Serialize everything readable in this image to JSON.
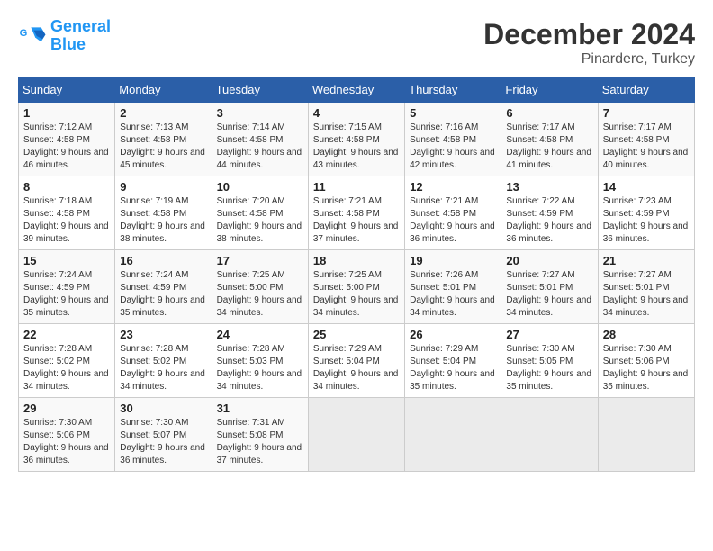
{
  "logo": {
    "line1": "General",
    "line2": "Blue"
  },
  "title": "December 2024",
  "subtitle": "Pinardere, Turkey",
  "days_header": [
    "Sunday",
    "Monday",
    "Tuesday",
    "Wednesday",
    "Thursday",
    "Friday",
    "Saturday"
  ],
  "weeks": [
    [
      {
        "num": "1",
        "sunrise": "Sunrise: 7:12 AM",
        "sunset": "Sunset: 4:58 PM",
        "daylight": "Daylight: 9 hours and 46 minutes."
      },
      {
        "num": "2",
        "sunrise": "Sunrise: 7:13 AM",
        "sunset": "Sunset: 4:58 PM",
        "daylight": "Daylight: 9 hours and 45 minutes."
      },
      {
        "num": "3",
        "sunrise": "Sunrise: 7:14 AM",
        "sunset": "Sunset: 4:58 PM",
        "daylight": "Daylight: 9 hours and 44 minutes."
      },
      {
        "num": "4",
        "sunrise": "Sunrise: 7:15 AM",
        "sunset": "Sunset: 4:58 PM",
        "daylight": "Daylight: 9 hours and 43 minutes."
      },
      {
        "num": "5",
        "sunrise": "Sunrise: 7:16 AM",
        "sunset": "Sunset: 4:58 PM",
        "daylight": "Daylight: 9 hours and 42 minutes."
      },
      {
        "num": "6",
        "sunrise": "Sunrise: 7:17 AM",
        "sunset": "Sunset: 4:58 PM",
        "daylight": "Daylight: 9 hours and 41 minutes."
      },
      {
        "num": "7",
        "sunrise": "Sunrise: 7:17 AM",
        "sunset": "Sunset: 4:58 PM",
        "daylight": "Daylight: 9 hours and 40 minutes."
      }
    ],
    [
      {
        "num": "8",
        "sunrise": "Sunrise: 7:18 AM",
        "sunset": "Sunset: 4:58 PM",
        "daylight": "Daylight: 9 hours and 39 minutes."
      },
      {
        "num": "9",
        "sunrise": "Sunrise: 7:19 AM",
        "sunset": "Sunset: 4:58 PM",
        "daylight": "Daylight: 9 hours and 38 minutes."
      },
      {
        "num": "10",
        "sunrise": "Sunrise: 7:20 AM",
        "sunset": "Sunset: 4:58 PM",
        "daylight": "Daylight: 9 hours and 38 minutes."
      },
      {
        "num": "11",
        "sunrise": "Sunrise: 7:21 AM",
        "sunset": "Sunset: 4:58 PM",
        "daylight": "Daylight: 9 hours and 37 minutes."
      },
      {
        "num": "12",
        "sunrise": "Sunrise: 7:21 AM",
        "sunset": "Sunset: 4:58 PM",
        "daylight": "Daylight: 9 hours and 36 minutes."
      },
      {
        "num": "13",
        "sunrise": "Sunrise: 7:22 AM",
        "sunset": "Sunset: 4:59 PM",
        "daylight": "Daylight: 9 hours and 36 minutes."
      },
      {
        "num": "14",
        "sunrise": "Sunrise: 7:23 AM",
        "sunset": "Sunset: 4:59 PM",
        "daylight": "Daylight: 9 hours and 36 minutes."
      }
    ],
    [
      {
        "num": "15",
        "sunrise": "Sunrise: 7:24 AM",
        "sunset": "Sunset: 4:59 PM",
        "daylight": "Daylight: 9 hours and 35 minutes."
      },
      {
        "num": "16",
        "sunrise": "Sunrise: 7:24 AM",
        "sunset": "Sunset: 4:59 PM",
        "daylight": "Daylight: 9 hours and 35 minutes."
      },
      {
        "num": "17",
        "sunrise": "Sunrise: 7:25 AM",
        "sunset": "Sunset: 5:00 PM",
        "daylight": "Daylight: 9 hours and 34 minutes."
      },
      {
        "num": "18",
        "sunrise": "Sunrise: 7:25 AM",
        "sunset": "Sunset: 5:00 PM",
        "daylight": "Daylight: 9 hours and 34 minutes."
      },
      {
        "num": "19",
        "sunrise": "Sunrise: 7:26 AM",
        "sunset": "Sunset: 5:01 PM",
        "daylight": "Daylight: 9 hours and 34 minutes."
      },
      {
        "num": "20",
        "sunrise": "Sunrise: 7:27 AM",
        "sunset": "Sunset: 5:01 PM",
        "daylight": "Daylight: 9 hours and 34 minutes."
      },
      {
        "num": "21",
        "sunrise": "Sunrise: 7:27 AM",
        "sunset": "Sunset: 5:01 PM",
        "daylight": "Daylight: 9 hours and 34 minutes."
      }
    ],
    [
      {
        "num": "22",
        "sunrise": "Sunrise: 7:28 AM",
        "sunset": "Sunset: 5:02 PM",
        "daylight": "Daylight: 9 hours and 34 minutes."
      },
      {
        "num": "23",
        "sunrise": "Sunrise: 7:28 AM",
        "sunset": "Sunset: 5:02 PM",
        "daylight": "Daylight: 9 hours and 34 minutes."
      },
      {
        "num": "24",
        "sunrise": "Sunrise: 7:28 AM",
        "sunset": "Sunset: 5:03 PM",
        "daylight": "Daylight: 9 hours and 34 minutes."
      },
      {
        "num": "25",
        "sunrise": "Sunrise: 7:29 AM",
        "sunset": "Sunset: 5:04 PM",
        "daylight": "Daylight: 9 hours and 34 minutes."
      },
      {
        "num": "26",
        "sunrise": "Sunrise: 7:29 AM",
        "sunset": "Sunset: 5:04 PM",
        "daylight": "Daylight: 9 hours and 35 minutes."
      },
      {
        "num": "27",
        "sunrise": "Sunrise: 7:30 AM",
        "sunset": "Sunset: 5:05 PM",
        "daylight": "Daylight: 9 hours and 35 minutes."
      },
      {
        "num": "28",
        "sunrise": "Sunrise: 7:30 AM",
        "sunset": "Sunset: 5:06 PM",
        "daylight": "Daylight: 9 hours and 35 minutes."
      }
    ],
    [
      {
        "num": "29",
        "sunrise": "Sunrise: 7:30 AM",
        "sunset": "Sunset: 5:06 PM",
        "daylight": "Daylight: 9 hours and 36 minutes."
      },
      {
        "num": "30",
        "sunrise": "Sunrise: 7:30 AM",
        "sunset": "Sunset: 5:07 PM",
        "daylight": "Daylight: 9 hours and 36 minutes."
      },
      {
        "num": "31",
        "sunrise": "Sunrise: 7:31 AM",
        "sunset": "Sunset: 5:08 PM",
        "daylight": "Daylight: 9 hours and 37 minutes."
      },
      null,
      null,
      null,
      null
    ]
  ]
}
